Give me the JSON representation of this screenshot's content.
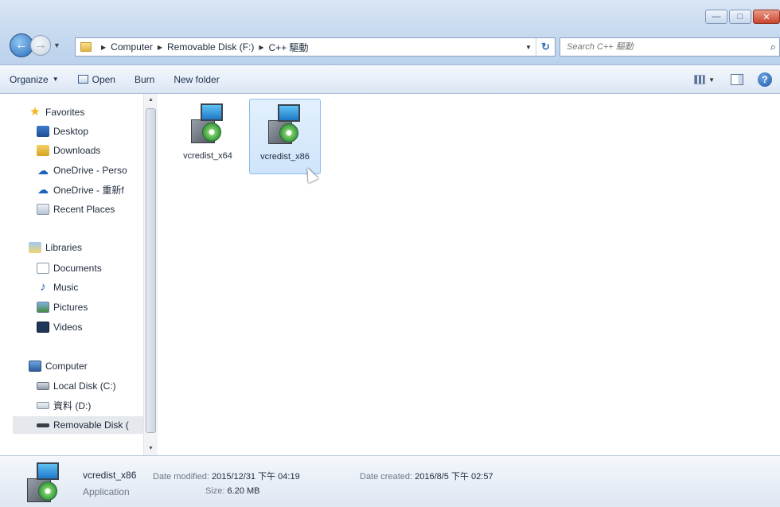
{
  "window": {
    "minimize_glyph": "—",
    "maximize_glyph": "□",
    "close_glyph": "✕"
  },
  "address_bar": {
    "crumbs": [
      "Computer",
      "Removable Disk (F:)",
      "C++ 驅動"
    ],
    "refresh_glyph": "↻"
  },
  "search": {
    "placeholder": "Search C++ 驅動"
  },
  "toolbar": {
    "organize": "Organize",
    "open": "Open",
    "burn": "Burn",
    "new_folder": "New folder"
  },
  "nav_pane": {
    "favorites_header": "Favorites",
    "favorites": [
      "Desktop",
      "Downloads",
      "OneDrive - Perso",
      "OneDrive - 重新f",
      "Recent Places"
    ],
    "libraries_header": "Libraries",
    "libraries": [
      "Documents",
      "Music",
      "Pictures",
      "Videos"
    ],
    "computer_header": "Computer",
    "drives": [
      "Local Disk (C:)",
      "資料 (D:)",
      "Removable Disk ("
    ]
  },
  "files": [
    {
      "name": "vcredist_x64",
      "selected": false
    },
    {
      "name": "vcredist_x86",
      "selected": true
    }
  ],
  "details": {
    "name": "vcredist_x86",
    "type": "Application",
    "date_modified_label": "Date modified:",
    "date_modified": "2015/12/31 下午 04:19",
    "date_created_label": "Date created:",
    "date_created": "2016/8/5 下午 02:57",
    "size_label": "Size:",
    "size": "6.20 MB"
  },
  "icons": {
    "back": "back-arrow-icon",
    "forward": "forward-arrow-icon",
    "search": "magnifier-icon",
    "help": "question-icon"
  }
}
